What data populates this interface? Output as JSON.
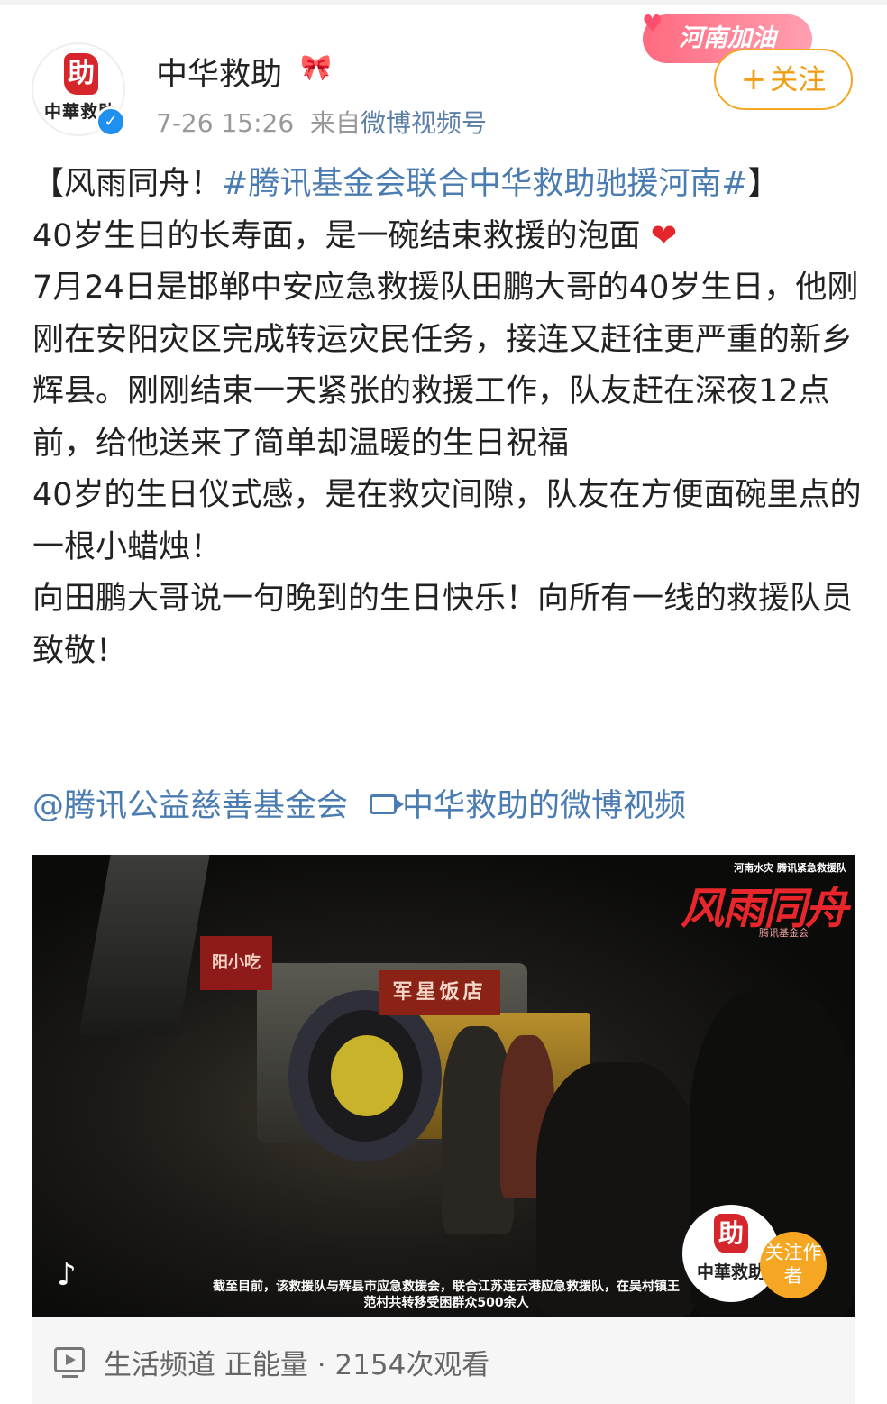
{
  "post": {
    "username": "中华救助",
    "avatar_text": "中華救助",
    "avatar_seal": "助",
    "timestamp": "7-26 15:26",
    "source_prefix": "来自",
    "source": "微博视频号",
    "badge": "河南加油",
    "follow_button": "关注",
    "paragraph_title_open": "【风雨同舟！",
    "topic": "#腾讯基金会联合中华救助驰援河南#",
    "paragraph_title_close": "】",
    "line_1": "40岁生日的长寿面，是一碗结束救援的泡面",
    "line_2": "7月24日是邯郸中安应急救援队田鹏大哥的40岁生日，他刚刚在安阳灾区完成转运灾民任务，接连又赶往更严重的新乡辉县。刚刚结束一天紧张的救援工作，队友赶在深夜12点前，给他送来了简单却温暖的生日祝福",
    "line_3": "40岁的生日仪式感，是在救灾间隙，队友在方便面碗里点的一根小蜡烛！",
    "line_4": "向田鹏大哥说一句晚到的生日快乐！向所有一线的救援队员致敬！",
    "mention": "@腾讯公益慈善基金会",
    "video_link": "中华救助的微博视频"
  },
  "video": {
    "overlay_small_title": "河南水灾 腾讯紧急救援队",
    "overlay_title": "风雨同舟",
    "overlay_fund": "腾讯基金会",
    "sign_left": "阳小吃",
    "sign_shop": "军星饭店",
    "caption": "截至目前，该救援队与辉县市应急救援会，联合江苏连云港应急救援队，在吴村镇王范村共转移受困群众500余人",
    "author_follow": "关注作者"
  },
  "footer": {
    "channel": "生活频道 正能量 · 2154次观看"
  },
  "icons": {
    "verified": "verified-check-icon",
    "music": "music-note-icon",
    "heart": "heart-icon",
    "play": "video-play-icon"
  },
  "colors": {
    "link": "#4a7cb2",
    "follow": "#f39c12",
    "brand_red": "#d6262b"
  }
}
